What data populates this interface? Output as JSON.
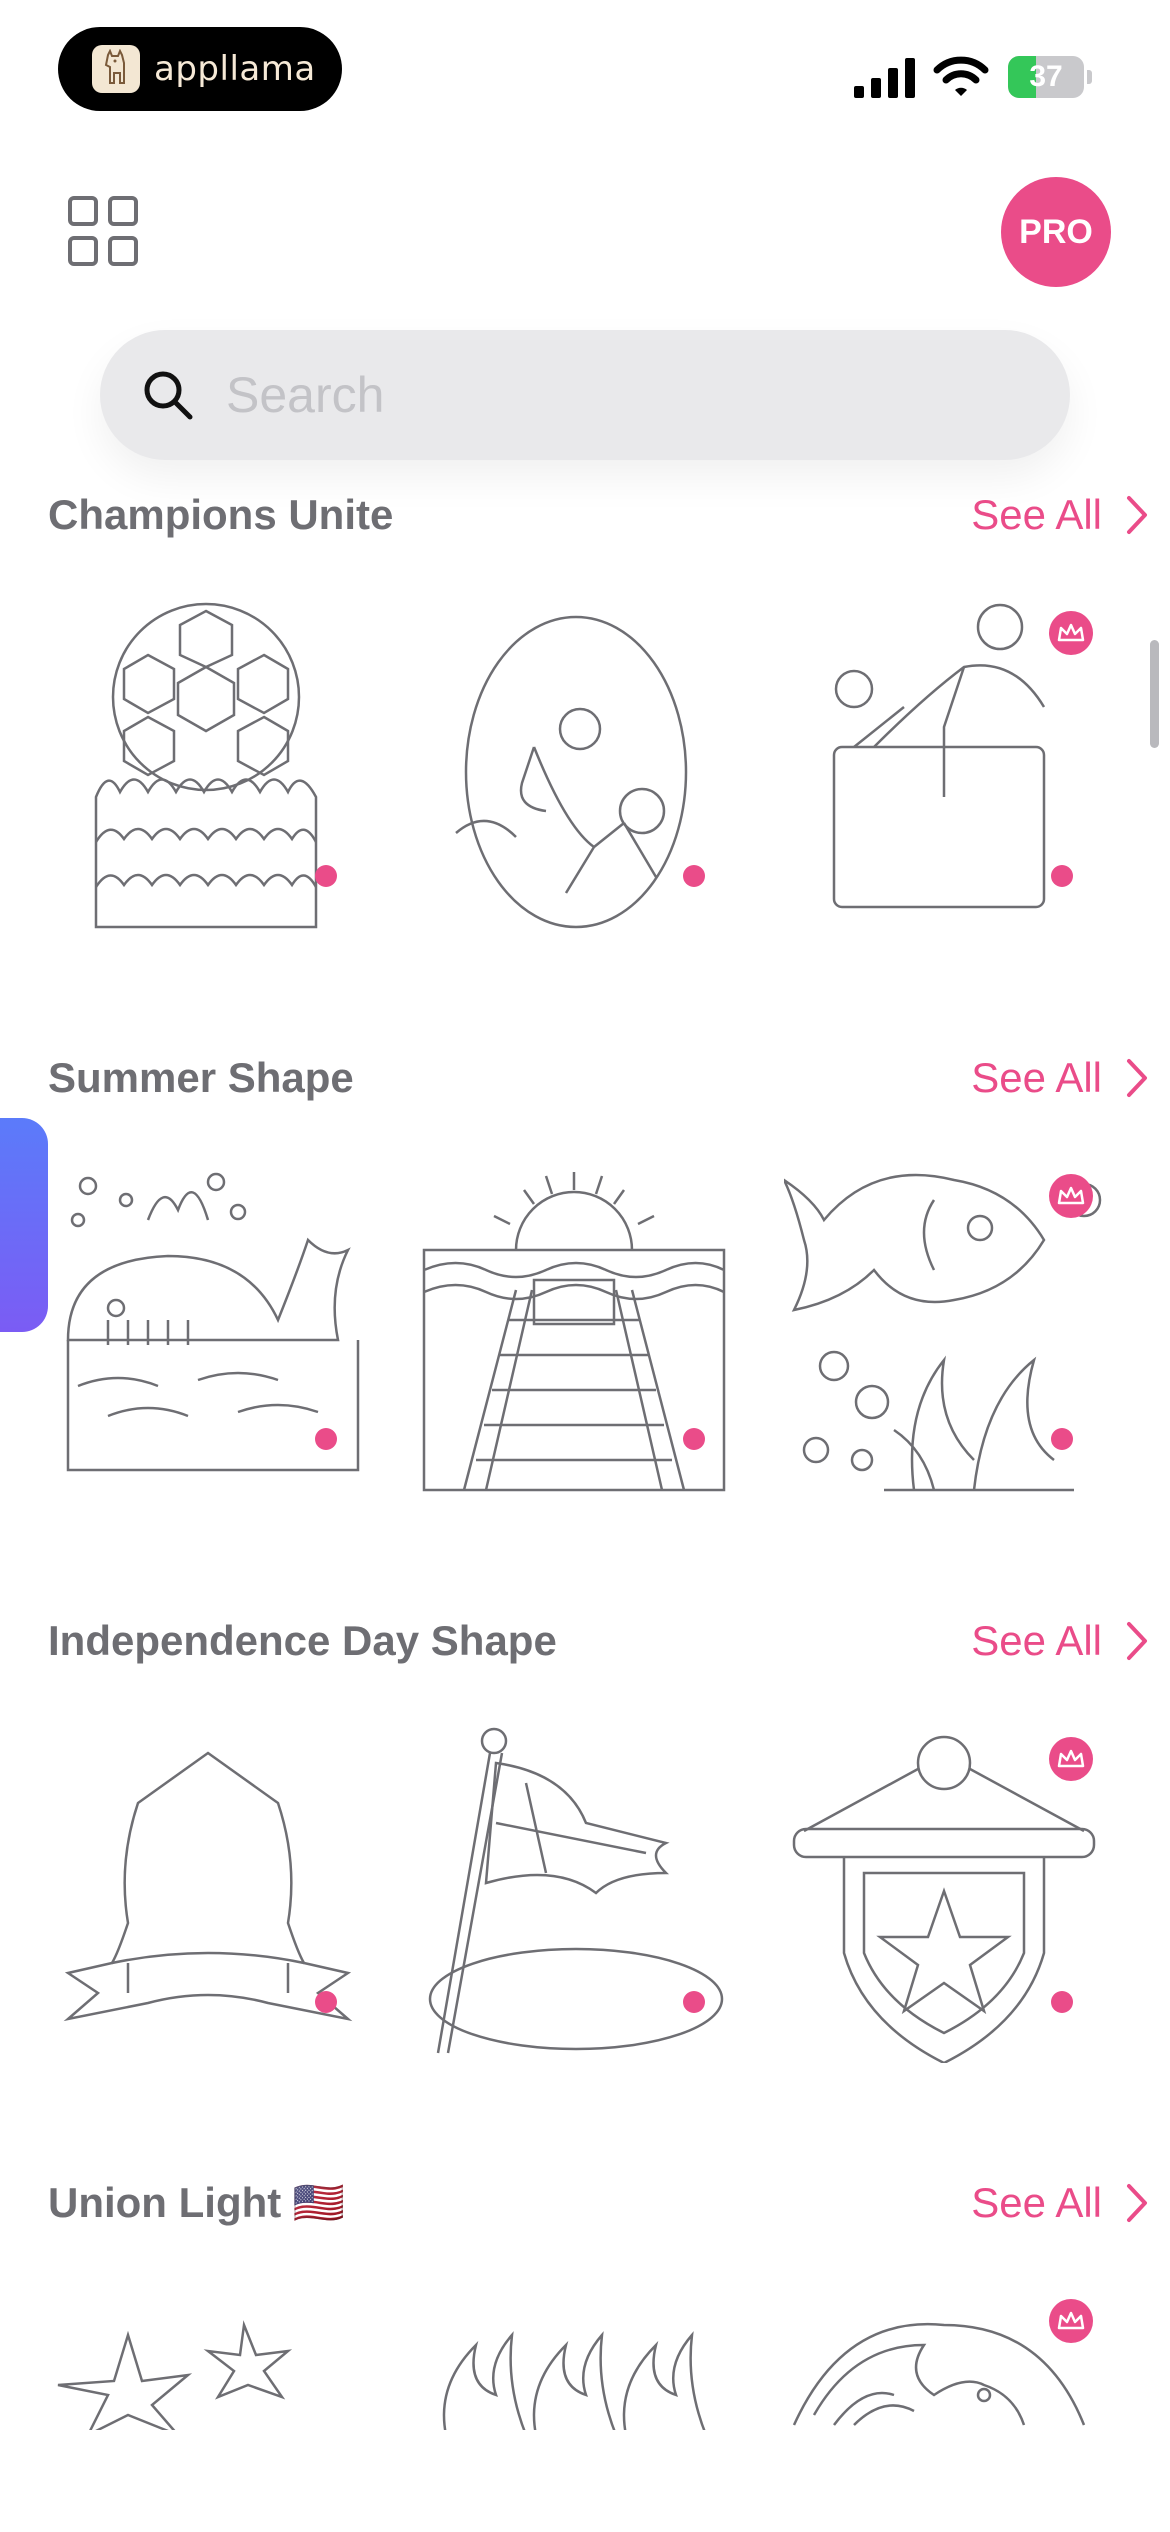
{
  "status_bar": {
    "app_pill_label": "appllama",
    "battery_percent": 37,
    "battery_label": "37"
  },
  "header": {
    "pro_label": "PRO"
  },
  "search": {
    "placeholder": "Search"
  },
  "sections": [
    {
      "title": "Champions Unite",
      "see_all": "See All",
      "items": [
        {
          "shape": "soccer-ball-trophy-outline",
          "premium": false
        },
        {
          "shape": "bicycle-kick-oval-outline",
          "premium": false
        },
        {
          "shape": "hurdle-jumper-box-outline",
          "premium": true
        }
      ]
    },
    {
      "title": "Summer Shape",
      "see_all": "See All",
      "items": [
        {
          "shape": "whale-waves-outline",
          "premium": false
        },
        {
          "shape": "sunset-pier-outline",
          "premium": false
        },
        {
          "shape": "fish-seaweed-bubbles-outline",
          "premium": true
        }
      ]
    },
    {
      "title": "Independence Day Shape",
      "see_all": "See All",
      "items": [
        {
          "shape": "dome-banner-outline",
          "premium": false
        },
        {
          "shape": "waving-flag-oval-outline",
          "premium": false
        },
        {
          "shape": "star-shield-pennant-outline",
          "premium": true
        }
      ]
    },
    {
      "title": "Union Light 🇺🇸",
      "see_all": "See All",
      "items": [
        {
          "shape": "starburst-outline",
          "premium": false
        },
        {
          "shape": "flames-outline",
          "premium": false
        },
        {
          "shape": "eagle-circle-outline",
          "premium": true
        }
      ]
    }
  ],
  "colors": {
    "accent": "#ea4c89",
    "outline": "#6e6e73",
    "search_bg": "#e9e9eb",
    "battery_green": "#34c759",
    "side_tab": "#6b6cf7"
  }
}
